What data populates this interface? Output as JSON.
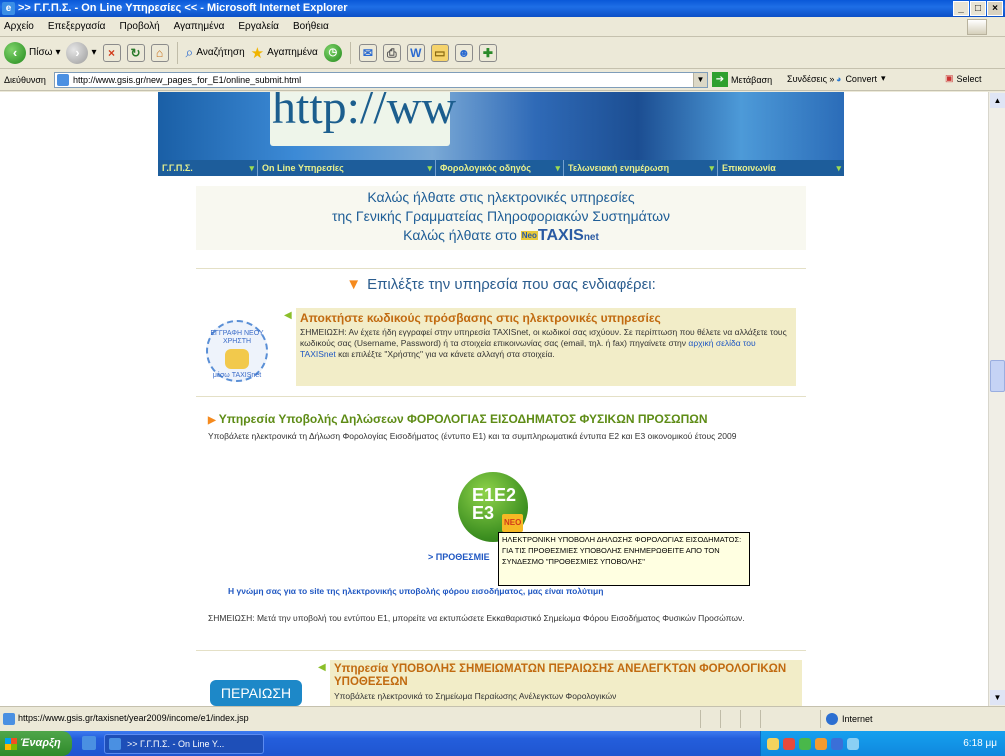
{
  "window": {
    "title": ">> Γ.Γ.Π.Σ. - On Line Υπηρεσίες << - Microsoft Internet Explorer"
  },
  "menu": [
    "Αρχείο",
    "Επεξεργασία",
    "Προβολή",
    "Αγαπημένα",
    "Εργαλεία",
    "Βοήθεια"
  ],
  "toolbar": {
    "back": "Πίσω",
    "search": "Αναζήτηση",
    "favorites": "Αγαπημένα"
  },
  "address": {
    "label": "Διεύθυνση",
    "url": "http://www.gsis.gr/new_pages_for_E1/online_submit.html",
    "go": "Μετάβαση",
    "links": "Συνδέσεις",
    "convert": "Convert",
    "select": "Select"
  },
  "banner": {
    "http_text": "http://ww",
    "nav": [
      "Γ.Γ.Π.Σ.",
      "On Line Υπηρεσίες",
      "Φορολογικός οδηγός",
      "Τελωνειακή ενημέρωση",
      "Επικοινωνία"
    ]
  },
  "welcome": {
    "line1": "Καλώς ήλθατε στις ηλεκτρονικές υπηρεσίες",
    "line2": "της Γενικής Γραμματείας Πληροφοριακών Συστημάτων",
    "line3": "Καλώς ήλθατε στο",
    "logo_neo": "Neo",
    "logo": "TAXIS",
    "logo_net": "net"
  },
  "choose": "Επιλέξτε την υπηρεσία που σας ενδιαφέρει:",
  "section1": {
    "badge_top": "ΕΓΓΡΑΦΗ ΝΕΟΥ ΧΡΗΣΤΗ",
    "badge_bottom": "μέσω TAXISnet",
    "title": "Αποκτήστε κωδικούς πρόσβασης στις ηλεκτρονικές υπηρεσίες",
    "note": "ΣΗΜΕΙΩΣΗ: Αν έχετε ήδη εγγραφεί στην υπηρεσία TAXISnet, οι κωδικοί σας ισχύουν. Σε περίπτωση που θέλετε να αλλάξετε τους κωδικούς σας (Username, Password) ή τα στοιχεία επικοινωνίας σας (email, τηλ. ή fax) πηγαίνετε στην",
    "link": "αρχική σελίδα του TAXISnet",
    "note_end": "και επιλέξτε \"Χρήστης\" για να κάνετε αλλαγή στα στοιχεία."
  },
  "section2": {
    "title": "Υπηρεσία Υποβολής Δηλώσεων ΦΟΡΟΛΟΓΙΑΣ ΕΙΣΟΔΗΜΑΤΟΣ ΦΥΣΙΚΩΝ ΠΡΟΣΩΠΩΝ",
    "desc": "Υποβάλετε ηλεκτρονικά τη Δήλωση Φορολογίας Εισοδήματος (έντυπο Ε1) και τα συμπληρωματικά έντυπα Ε2 και Ε3 οικονομικού έτους 2009",
    "e1_lines": [
      "E1E2",
      "E3"
    ],
    "neo": "ΝΕΟ",
    "deadlines": "> ΠΡΟΘΕΣΜΙΕ",
    "tooltip": "ΗΛΕΚΤΡΟΝΙΚΗ ΥΠΟΒΟΛΗ ΔΗΛΩΣΗΣ ΦΟΡΟΛΟΓΙΑΣ ΕΙΣΟΔΗΜΑΤΟΣ: ΓΙΑ ΤΙΣ ΠΡΟΘΕΣΜΙΕΣ ΥΠΟΒΟΛΗΣ ΕΝΗΜΕΡΩΘΕΙΤΕ ΑΠΟ ΤΟΝ ΣΥΝΔΕΣΜΟ \"ΠΡΟΘΕΣΜΙΕΣ ΥΠΟΒΟΛΗΣ\"",
    "opinion": "Η γνώμη σας για το site της ηλεκτρονικής υποβολής φόρου εισοδήματος, μας είναι πολύτιμη",
    "note": "ΣΗΜΕΙΩΣΗ: Μετά την υποβολή του εντύπου Ε1, μπορείτε να εκτυπώσετε Εκκαθαριστικό Σημείωμα Φόρου Εισοδήματος Φυσικών Προσώπων."
  },
  "section3": {
    "badge": "ΠΕΡΑΙΩΣΗ",
    "title": "Υπηρεσία ΥΠΟΒΟΛΗΣ ΣΗΜΕΙΩΜΑΤΩΝ ΠΕΡΑΙΩΣΗΣ ΑΝΕΛΕΓΚΤΩΝ ΦΟΡΟΛΟΓΙΚΩΝ ΥΠΟΘΕΣΕΩΝ",
    "desc": "Υποβάλετε ηλεκτρονικά το Σημείωμα Περαίωσης Ανέλεγκτων Φορολογικών"
  },
  "status": {
    "url": "https://www.gsis.gr/taxisnet/year2009/income/e1/index.jsp",
    "zone": "Internet"
  },
  "taskbar": {
    "start": "Έναρξη",
    "task": ">> Γ.Γ.Π.Σ. - On Line Y...",
    "clock": "6:18 μμ"
  }
}
